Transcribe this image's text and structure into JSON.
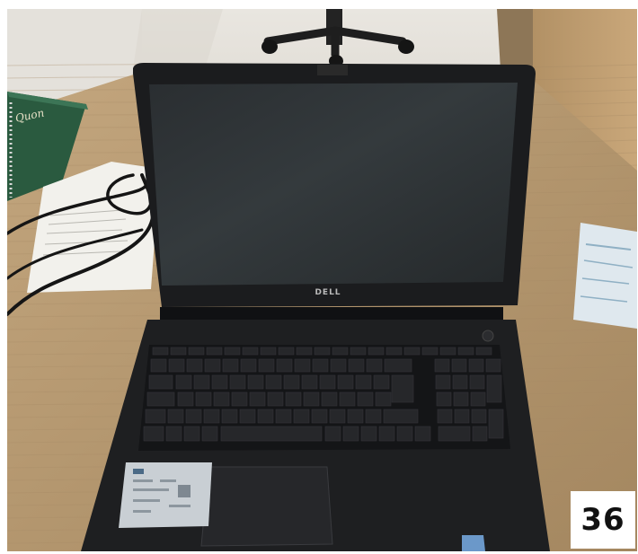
{
  "photo": {
    "number_label": "36",
    "laptop_brand": "DELL",
    "notebook_cover_text": "Quon"
  },
  "colors": {
    "desk": "#b79a73",
    "laptop_body": "#1b1c1e",
    "screen": "#2c3033",
    "wall": "#dfdcd6",
    "floor": "#e7e4de"
  }
}
